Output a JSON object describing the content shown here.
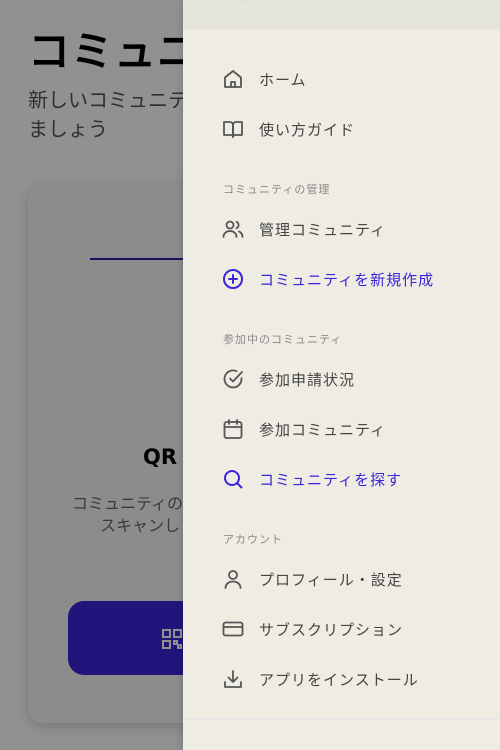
{
  "background": {
    "title": "コミュニ",
    "subtitle_lines": [
      "新しいコミュニテ",
      "ましょう"
    ],
    "qr_title": "QR",
    "qr_desc_lines": [
      "コミュニティの",
      "スキャンし"
    ]
  },
  "menu": {
    "items_top": [
      {
        "label": "ホーム",
        "icon": "home-icon"
      },
      {
        "label": "使い方ガイド",
        "icon": "book-icon"
      }
    ],
    "sections": [
      {
        "title": "コミュニティの管理",
        "items": [
          {
            "label": "管理コミュニティ",
            "icon": "users-icon"
          },
          {
            "label": "コミュニティを新規作成",
            "icon": "plus-circle-icon",
            "accent": true
          }
        ]
      },
      {
        "title": "参加中のコミュニティ",
        "items": [
          {
            "label": "参加申請状況",
            "icon": "check-circle-icon"
          },
          {
            "label": "参加コミュニティ",
            "icon": "calendar-icon"
          },
          {
            "label": "コミュニティを探す",
            "icon": "search-icon",
            "accent": true
          }
        ]
      },
      {
        "title": "アカウント",
        "items": [
          {
            "label": "プロフィール・設定",
            "icon": "user-icon"
          },
          {
            "label": "サブスクリプション",
            "icon": "credit-card-icon"
          },
          {
            "label": "アプリをインストール",
            "icon": "download-icon"
          }
        ]
      }
    ]
  },
  "colors": {
    "accent": "#3a25d8",
    "drawer_bg": "#efede3"
  }
}
